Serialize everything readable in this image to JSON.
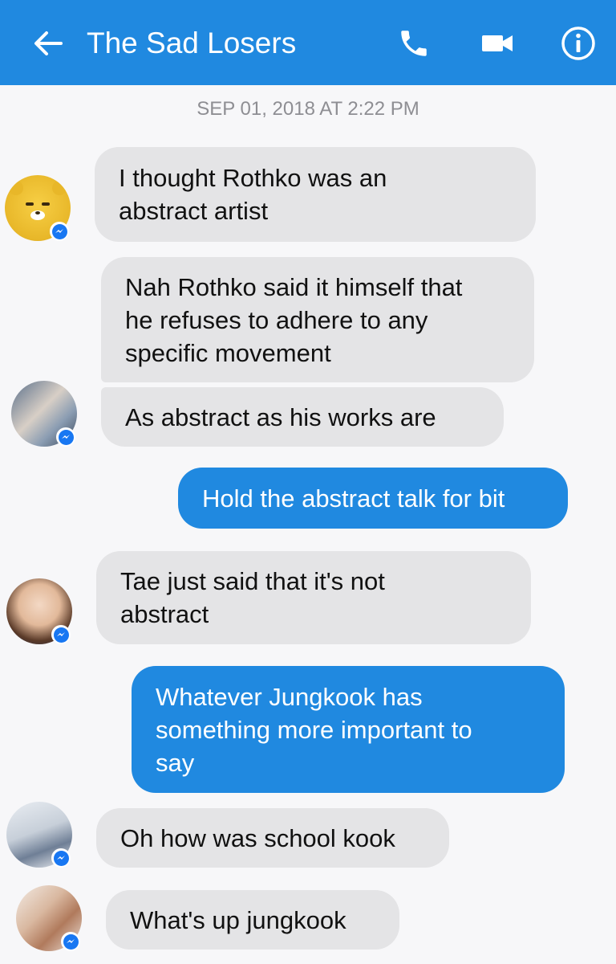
{
  "header": {
    "back_icon": "arrow-left-icon",
    "title": "The Sad Losers",
    "call_icon": "phone-icon",
    "video_icon": "video-camera-icon",
    "info_icon": "info-icon",
    "accent_color": "#2089e0"
  },
  "timestamp": "SEP 01, 2018 AT 2:22 PM",
  "messages": [
    {
      "direction": "incoming",
      "lines": [
        "I thought Rothko was an",
        "abstract artist"
      ]
    },
    {
      "direction": "incoming",
      "lines": [
        "Nah Rothko said it himself that",
        "he refuses to adhere to any",
        "specific movement"
      ]
    },
    {
      "direction": "incoming",
      "lines": [
        "As abstract as his works are"
      ]
    },
    {
      "direction": "outgoing",
      "lines": [
        "Hold the abstract talk for bit"
      ]
    },
    {
      "direction": "incoming",
      "lines": [
        "Tae just said that it's not",
        "abstract"
      ]
    },
    {
      "direction": "outgoing",
      "lines": [
        "Whatever Jungkook has",
        "something more important to",
        "say"
      ]
    },
    {
      "direction": "incoming",
      "lines": [
        "Oh how was school kook"
      ]
    },
    {
      "direction": "incoming",
      "lines": [
        "What's up jungkook"
      ]
    }
  ],
  "colors": {
    "incoming_bubble": "#e4e4e6",
    "outgoing_bubble": "#2089e0",
    "messenger_badge": "#1877f2"
  }
}
